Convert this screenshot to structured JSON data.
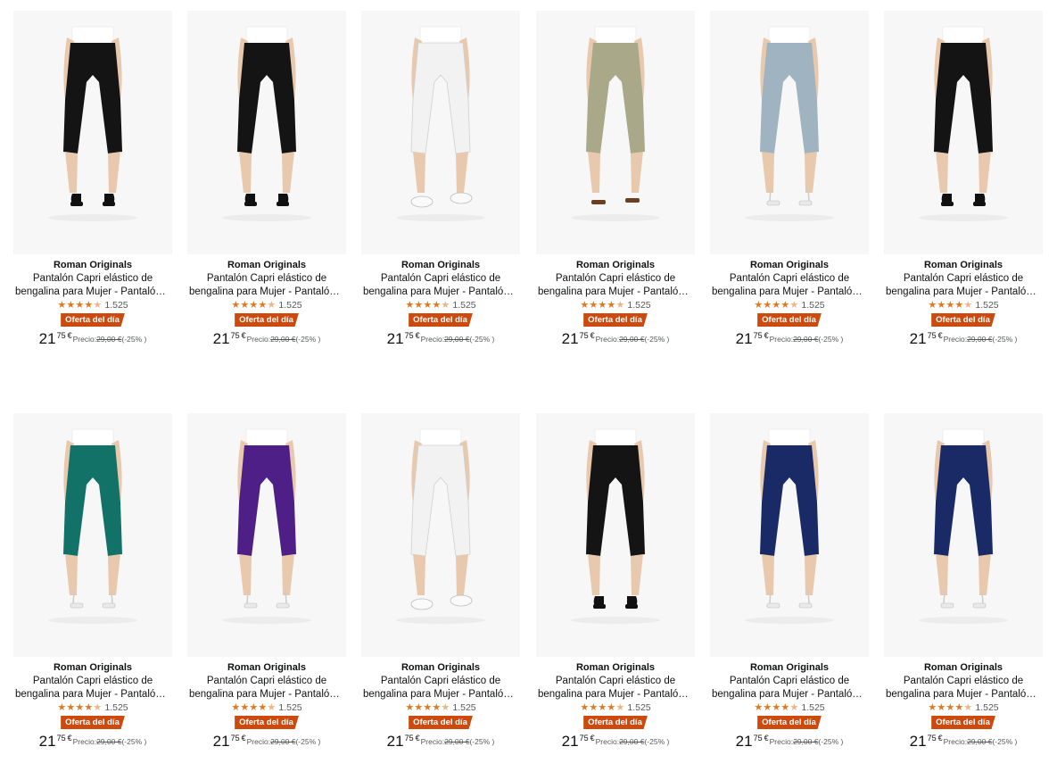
{
  "products": [
    {
      "brand": "Roman Originals",
      "title_line1": "Pantalón Capri elástico de",
      "title_line2": "bengalina para Mujer - Pantalón ...",
      "rating_count": "1.525",
      "deal_label": "Oferta del día",
      "price_whole": "21",
      "price_fraction": "75",
      "currency": "€",
      "list_price_label": "Precio:",
      "list_price": "29,00 €",
      "discount": "(-25% )",
      "pants_color": "#141414",
      "shoe": "black-heels"
    },
    {
      "brand": "Roman Originals",
      "title_line1": "Pantalón Capri elástico de",
      "title_line2": "bengalina para Mujer - Pantalón ...",
      "rating_count": "1.525",
      "deal_label": "Oferta del día",
      "price_whole": "21",
      "price_fraction": "75",
      "currency": "€",
      "list_price_label": "Precio:",
      "list_price": "29,00 €",
      "discount": "(-25% )",
      "pants_color": "#141414",
      "shoe": "black-heels"
    },
    {
      "brand": "Roman Originals",
      "title_line1": "Pantalón Capri elástico de",
      "title_line2": "bengalina para Mujer - Pantalón ...",
      "rating_count": "1.525",
      "deal_label": "Oferta del día",
      "price_whole": "21",
      "price_fraction": "75",
      "currency": "€",
      "list_price_label": "Precio:",
      "list_price": "29,00 €",
      "discount": "(-25% )",
      "pants_color": "#f2f2f2",
      "shoe": "white-sneakers"
    },
    {
      "brand": "Roman Originals",
      "title_line1": "Pantalón Capri elástico de",
      "title_line2": "bengalina para Mujer - Pantalón ...",
      "rating_count": "1.525",
      "deal_label": "Oferta del día",
      "price_whole": "21",
      "price_fraction": "75",
      "currency": "€",
      "list_price_label": "Precio:",
      "list_price": "29,00 €",
      "discount": "(-25% )",
      "pants_color": "#a9a98a",
      "shoe": "brown-sandals"
    },
    {
      "brand": "Roman Originals",
      "title_line1": "Pantalón Capri elástico de",
      "title_line2": "bengalina para Mujer - Pantalón ...",
      "rating_count": "1.525",
      "deal_label": "Oferta del día",
      "price_whole": "21",
      "price_fraction": "75",
      "currency": "€",
      "list_price_label": "Precio:",
      "list_price": "29,00 €",
      "discount": "(-25% )",
      "pants_color": "#9fb3c1",
      "shoe": "white-heels"
    },
    {
      "brand": "Roman Originals",
      "title_line1": "Pantalón Capri elástico de",
      "title_line2": "bengalina para Mujer - Pantalón ...",
      "rating_count": "1.525",
      "deal_label": "Oferta del día",
      "price_whole": "21",
      "price_fraction": "75",
      "currency": "€",
      "list_price_label": "Precio:",
      "list_price": "29,00 €",
      "discount": "(-25% )",
      "pants_color": "#141414",
      "shoe": "black-heels"
    },
    {
      "brand": "Roman Originals",
      "title_line1": "Pantalón Capri elástico de",
      "title_line2": "bengalina para Mujer - Pantalón ...",
      "rating_count": "1.525",
      "deal_label": "Oferta del día",
      "price_whole": "21",
      "price_fraction": "75",
      "currency": "€",
      "list_price_label": "Precio:",
      "list_price": "29,00 €",
      "discount": "(-25% )",
      "pants_color": "#137267",
      "shoe": "white-heels"
    },
    {
      "brand": "Roman Originals",
      "title_line1": "Pantalón Capri elástico de",
      "title_line2": "bengalina para Mujer - Pantalón ...",
      "rating_count": "1.525",
      "deal_label": "Oferta del día",
      "price_whole": "21",
      "price_fraction": "75",
      "currency": "€",
      "list_price_label": "Precio:",
      "list_price": "29,00 €",
      "discount": "(-25% )",
      "pants_color": "#4e1f86",
      "shoe": "white-heels"
    },
    {
      "brand": "Roman Originals",
      "title_line1": "Pantalón Capri elástico de",
      "title_line2": "bengalina para Mujer - Pantalón ...",
      "rating_count": "1.525",
      "deal_label": "Oferta del día",
      "price_whole": "21",
      "price_fraction": "75",
      "currency": "€",
      "list_price_label": "Precio:",
      "list_price": "29,00 €",
      "discount": "(-25% )",
      "pants_color": "#f2f2f2",
      "shoe": "white-sneakers"
    },
    {
      "brand": "Roman Originals",
      "title_line1": "Pantalón Capri elástico de",
      "title_line2": "bengalina para Mujer - Pantalón ...",
      "rating_count": "1.525",
      "deal_label": "Oferta del día",
      "price_whole": "21",
      "price_fraction": "75",
      "currency": "€",
      "list_price_label": "Precio:",
      "list_price": "29,00 €",
      "discount": "(-25% )",
      "pants_color": "#141414",
      "shoe": "black-heels"
    },
    {
      "brand": "Roman Originals",
      "title_line1": "Pantalón Capri elástico de",
      "title_line2": "bengalina para Mujer - Pantalón ...",
      "rating_count": "1.525",
      "deal_label": "Oferta del día",
      "price_whole": "21",
      "price_fraction": "75",
      "currency": "€",
      "list_price_label": "Precio:",
      "list_price": "29,00 €",
      "discount": "(-25% )",
      "pants_color": "#1a2a66",
      "shoe": "white-heels"
    },
    {
      "brand": "Roman Originals",
      "title_line1": "Pantalón Capri elástico de",
      "title_line2": "bengalina para Mujer - Pantalón ...",
      "rating_count": "1.525",
      "deal_label": "Oferta del día",
      "price_whole": "21",
      "price_fraction": "75",
      "currency": "€",
      "list_price_label": "Precio:",
      "list_price": "29,00 €",
      "discount": "(-25% )",
      "pants_color": "#1a2a66",
      "shoe": "white-heels"
    }
  ],
  "rating_value": 4.5,
  "colors": {
    "deal_badge": "#cc4a0e",
    "star": "#de7921",
    "image_bg": "#f7f7f7"
  }
}
